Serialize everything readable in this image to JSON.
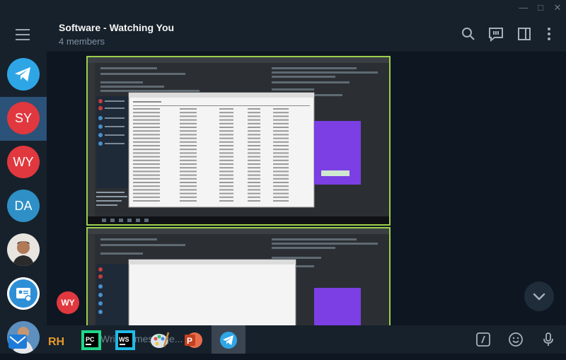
{
  "window": {
    "controls": [
      "—",
      "□",
      "✕"
    ]
  },
  "sidebar": {
    "menu_icon": "hamburger-icon",
    "chats": [
      {
        "initials": "",
        "color": "#2ea6e6",
        "kind": "telegram-logo"
      },
      {
        "initials": "SY",
        "color": "#e0383e",
        "kind": "initials"
      },
      {
        "initials": "WY",
        "color": "#e0383e",
        "kind": "initials"
      },
      {
        "initials": "DA",
        "color": "#2e90c6",
        "kind": "initials"
      },
      {
        "initials": "",
        "color": "#6b7780",
        "kind": "photo"
      },
      {
        "initials": "",
        "color": "#2e8fd6",
        "kind": "contact-card"
      },
      {
        "initials": "",
        "color": "#3a7bc4",
        "kind": "photo"
      }
    ]
  },
  "header": {
    "title": "Software - Watching You",
    "subtitle": "4 members"
  },
  "messages": {
    "sender_initials": "WY",
    "sender_color": "#e0383e"
  },
  "composer": {
    "placeholder": "Write a message..."
  },
  "taskbar": {
    "apps": [
      "mail-app-icon",
      "rh-app-icon",
      "pycharm-app-icon",
      "webstorm-app-icon",
      "paint-app-icon",
      "powerpoint-app-icon",
      "telegram-app-icon"
    ],
    "labels": {
      "rh": "RH",
      "pycharm": "PC",
      "webstorm": "WS",
      "powerpoint": "P"
    }
  }
}
